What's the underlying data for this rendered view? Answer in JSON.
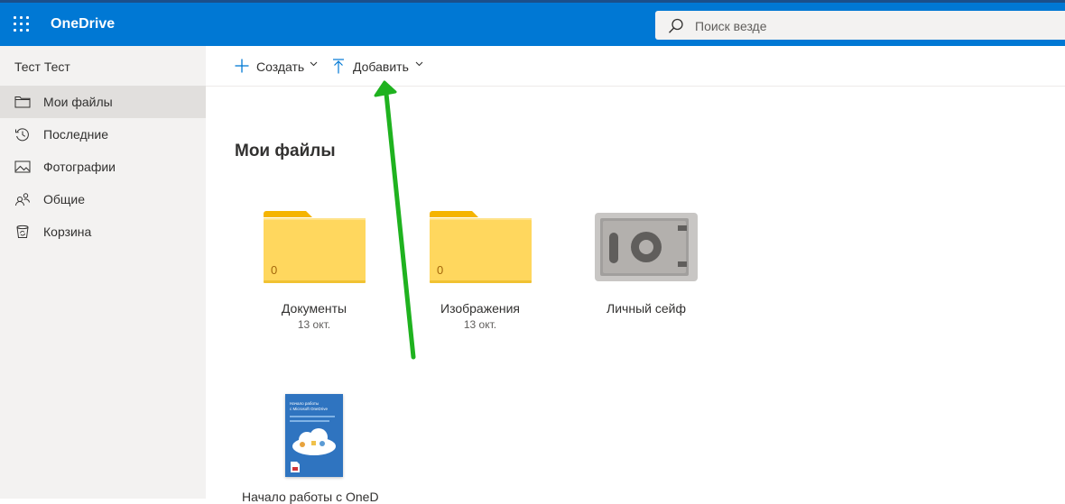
{
  "header": {
    "app_name": "OneDrive",
    "search_placeholder": "Поиск везде",
    "brand_color": "#0078d4"
  },
  "sidebar": {
    "user_name": "Тест Тест",
    "items": [
      {
        "label": "Мои файлы",
        "icon": "folder-icon",
        "active": true
      },
      {
        "label": "Последние",
        "icon": "recent-icon",
        "active": false
      },
      {
        "label": "Фотографии",
        "icon": "photos-icon",
        "active": false
      },
      {
        "label": "Общие",
        "icon": "shared-icon",
        "active": false
      },
      {
        "label": "Корзина",
        "icon": "recycle-bin-icon",
        "active": false
      }
    ]
  },
  "commands": {
    "create_label": "Создать",
    "upload_label": "Добавить"
  },
  "main": {
    "title": "Мои файлы",
    "items": [
      {
        "type": "folder",
        "name": "Документы",
        "date": "13 окт.",
        "count": "0"
      },
      {
        "type": "folder",
        "name": "Изображения",
        "date": "13 окт.",
        "count": "0"
      },
      {
        "type": "vault",
        "name": "Личный сейф"
      },
      {
        "type": "document",
        "name": "Начало работы с OneD"
      }
    ],
    "doc_thumb_lines": [
      "Начало работы",
      "с Microsoft OneDrive"
    ]
  },
  "annotation": {
    "arrow_color": "#1fb21f"
  }
}
